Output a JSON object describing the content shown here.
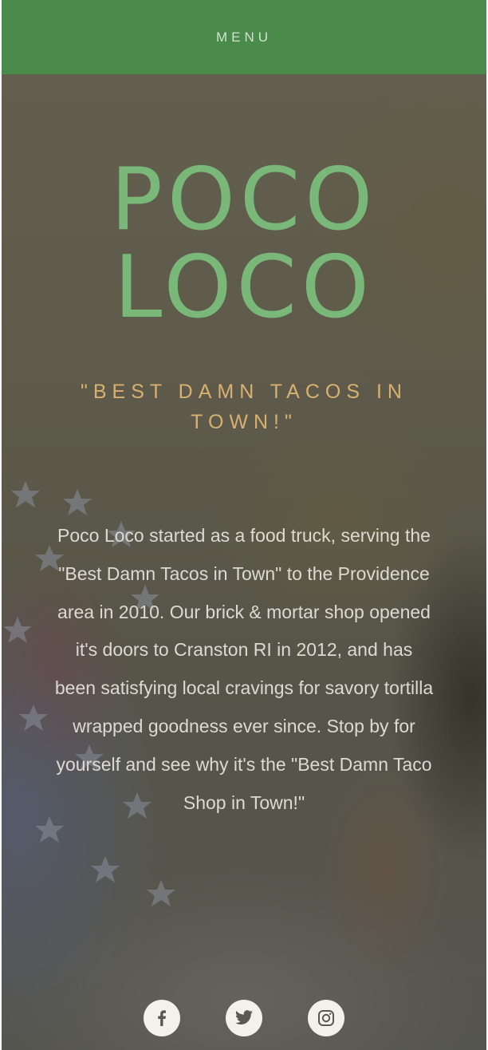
{
  "nav": {
    "menu_label": "MENU",
    "background_color": "#4a8a4a"
  },
  "hero": {
    "title_line1": "POCO",
    "title_line2": "LOCO",
    "tagline": "\"BEST DAMN TACOS IN TOWN!\"",
    "about_text": "Poco Loco started as a food truck, serving the \"Best Damn Tacos in Town\" to the Providence area in 2010. Our brick & mortar shop opened it's doors to Cranston RI in 2012, and has been satisfying local cravings for savory tortilla wrapped goodness ever since. Stop by for yourself and see why it's the \"Best Damn Taco Shop in Town!\"",
    "title_color": "#79b879",
    "tagline_color": "#d9b06e"
  },
  "social": {
    "icons": [
      "facebook-icon",
      "twitter-icon",
      "instagram-icon"
    ]
  }
}
